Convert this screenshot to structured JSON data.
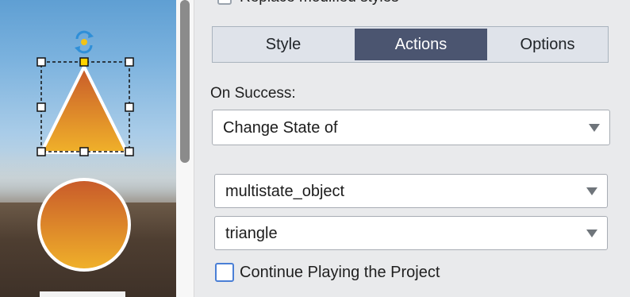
{
  "top_option": {
    "label": "Replace modified styles"
  },
  "tabs": [
    {
      "label": "Style"
    },
    {
      "label": "Actions"
    },
    {
      "label": "Options"
    }
  ],
  "active_tab": "Actions",
  "on_success": {
    "label": "On Success:",
    "selected": "Change State of"
  },
  "object_select": {
    "selected": "multistate_object"
  },
  "state_select": {
    "selected": "triangle"
  },
  "continue_playing": {
    "label": "Continue Playing the Project",
    "checked": false
  },
  "colors": {
    "tab_active_bg": "#4b5570",
    "shape_gradient_top": "#c85a2a",
    "shape_gradient_bottom": "#f0b12a",
    "selection_handle_active": "#ffd400",
    "checkbox_focus": "#4a7fd6"
  },
  "icons": {
    "rotate": "rotate-icon",
    "dropdown": "chevron-down-icon"
  }
}
